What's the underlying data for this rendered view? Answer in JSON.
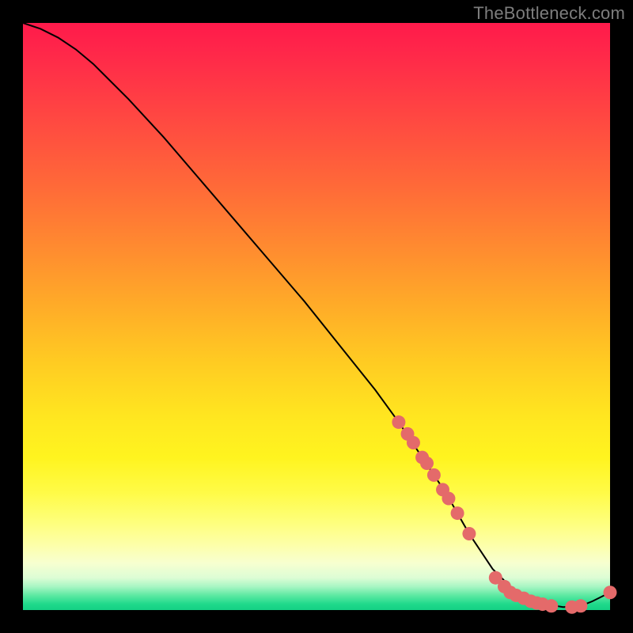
{
  "watermark": "TheBottleneck.com",
  "chart_data": {
    "type": "line",
    "title": "",
    "xlabel": "",
    "ylabel": "",
    "xlim": [
      0,
      100
    ],
    "ylim": [
      0,
      100
    ],
    "grid": false,
    "legend": false,
    "series": [
      {
        "name": "bottleneck-curve",
        "x": [
          0,
          3,
          6,
          9,
          12,
          18,
          24,
          30,
          36,
          42,
          48,
          54,
          60,
          64,
          66,
          68,
          70,
          72,
          74,
          76,
          78,
          80,
          83,
          86,
          89,
          92,
          95,
          97,
          100
        ],
        "y": [
          100,
          99,
          97.5,
          95.5,
          93,
          87,
          80.5,
          73.5,
          66.5,
          59.5,
          52.5,
          45,
          37.5,
          32,
          29,
          26,
          23,
          20,
          16.5,
          13,
          10,
          7,
          4,
          2,
          1,
          0.5,
          0.7,
          1.5,
          3
        ],
        "stroke": "#000000",
        "stroke_width": 2
      }
    ],
    "markers": [
      {
        "name": "highlight-points",
        "color": "#e46a6a",
        "radius": 8.5,
        "points": [
          {
            "x": 64.0,
            "y": 32.0
          },
          {
            "x": 65.5,
            "y": 30.0
          },
          {
            "x": 66.5,
            "y": 28.5
          },
          {
            "x": 68.0,
            "y": 26.0
          },
          {
            "x": 68.8,
            "y": 25.0
          },
          {
            "x": 70.0,
            "y": 23.0
          },
          {
            "x": 71.5,
            "y": 20.5
          },
          {
            "x": 72.5,
            "y": 19.0
          },
          {
            "x": 74.0,
            "y": 16.5
          },
          {
            "x": 76.0,
            "y": 13.0
          },
          {
            "x": 80.5,
            "y": 5.5
          },
          {
            "x": 82.0,
            "y": 4.0
          },
          {
            "x": 83.0,
            "y": 3.0
          },
          {
            "x": 84.0,
            "y": 2.5
          },
          {
            "x": 85.3,
            "y": 2.0
          },
          {
            "x": 86.5,
            "y": 1.5
          },
          {
            "x": 87.5,
            "y": 1.2
          },
          {
            "x": 88.5,
            "y": 1.0
          },
          {
            "x": 90.0,
            "y": 0.7
          },
          {
            "x": 93.5,
            "y": 0.5
          },
          {
            "x": 95.0,
            "y": 0.7
          },
          {
            "x": 100.0,
            "y": 3.0
          }
        ]
      }
    ]
  }
}
